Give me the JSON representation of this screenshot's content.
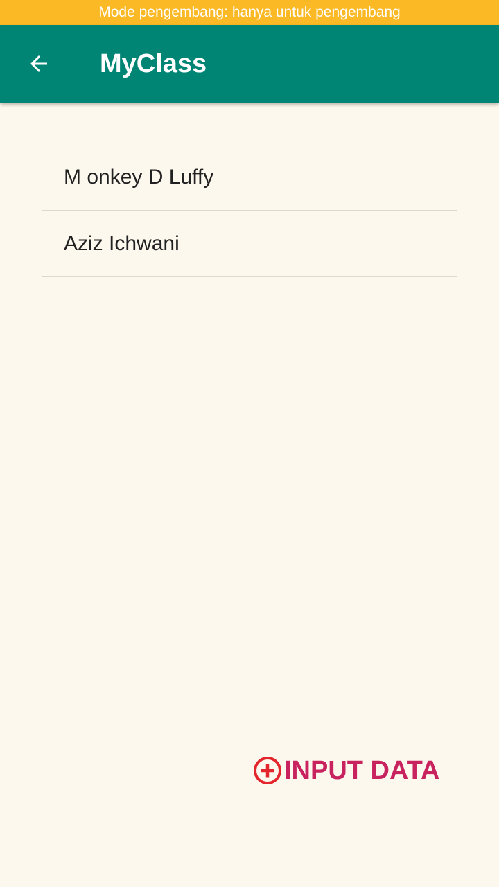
{
  "status_banner": {
    "text": "Mode pengembang: hanya untuk pengembang",
    "color": "#FBB925"
  },
  "app_bar": {
    "title": "MyClass",
    "back_icon": "arrow-back-icon",
    "color": "#008575"
  },
  "list": {
    "items": [
      {
        "label": "M onkey D Luffy"
      },
      {
        "label": "Aziz Ichwani"
      }
    ]
  },
  "fab": {
    "label": "INPUT DATA",
    "icon": "add-circle-icon",
    "text_color": "#C8235E",
    "icon_color": "#E3262E"
  },
  "background_color": "#FDF8EE"
}
